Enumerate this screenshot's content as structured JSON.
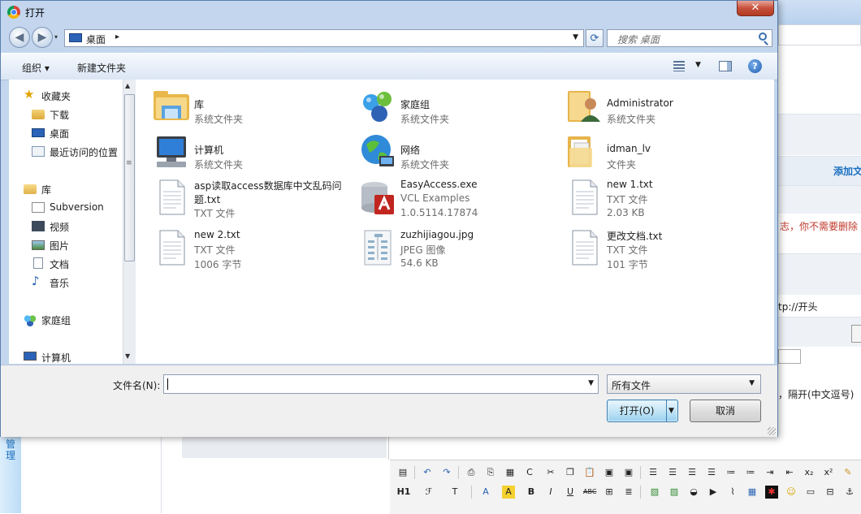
{
  "dialog": {
    "title": "打开",
    "close_glyph": "✕",
    "address": "桌面",
    "search_placeholder": "搜索 桌面",
    "toolbar": {
      "organize": "组织 ▾",
      "new_folder": "新建文件夹",
      "help_glyph": "?"
    },
    "nav": [
      {
        "label": "收藏夹",
        "icon": "star-icon"
      },
      {
        "label": "下载",
        "icon": "download-folder-icon"
      },
      {
        "label": "桌面",
        "icon": "desktop-icon"
      },
      {
        "label": "最近访问的位置",
        "icon": "recent-places-icon"
      },
      {
        "label": "库",
        "icon": "library-icon"
      },
      {
        "label": "Subversion",
        "icon": "folder-icon"
      },
      {
        "label": "视频",
        "icon": "video-icon"
      },
      {
        "label": "图片",
        "icon": "picture-icon"
      },
      {
        "label": "文档",
        "icon": "document-icon"
      },
      {
        "label": "音乐",
        "icon": "music-icon"
      },
      {
        "label": "家庭组",
        "icon": "homegroup-icon"
      },
      {
        "label": "计算机",
        "icon": "computer-icon"
      }
    ],
    "files": [
      {
        "name": "库",
        "sub1": "系统文件夹",
        "sub2": "",
        "icon": "library-icon"
      },
      {
        "name": "家庭组",
        "sub1": "系统文件夹",
        "sub2": "",
        "icon": "homegroup-icon"
      },
      {
        "name": "Administrator",
        "sub1": "系统文件夹",
        "sub2": "",
        "icon": "user-folder-icon"
      },
      {
        "name": "计算机",
        "sub1": "系统文件夹",
        "sub2": "",
        "icon": "computer-icon"
      },
      {
        "name": "网络",
        "sub1": "系统文件夹",
        "sub2": "",
        "icon": "network-icon"
      },
      {
        "name": "idman_lv",
        "sub1": "文件夹",
        "sub2": "",
        "icon": "folder-icon"
      },
      {
        "name": "asp读取access数据库中文乱码问",
        "name2": "题.txt",
        "sub1": "TXT 文件",
        "sub2": "",
        "icon": "text-file-icon"
      },
      {
        "name": "EasyAccess.exe",
        "sub1": "VCL Examples",
        "sub2": "1.0.5114.17874",
        "icon": "access-exe-icon"
      },
      {
        "name": "new 1.txt",
        "sub1": "TXT 文件",
        "sub2": "2.03 KB",
        "icon": "text-file-icon"
      },
      {
        "name": "new 2.txt",
        "sub1": "TXT 文件",
        "sub2": "1006 字节",
        "icon": "text-file-icon"
      },
      {
        "name": "zuzhijiagou.jpg",
        "sub1": "JPEG 图像",
        "sub2": "54.6 KB",
        "icon": "image-file-icon"
      },
      {
        "name": "更改文档.txt",
        "sub1": "TXT 文件",
        "sub2": "101 字节",
        "icon": "text-file-icon"
      }
    ],
    "filename_label": "文件名(N):",
    "filename_value": "",
    "filetype_value": "所有文件",
    "open_label": "打开(O)",
    "cancel_label": "取消"
  },
  "background": {
    "add_link": "添加文",
    "notice_text": "志，你不需要删除",
    "url_hint": "tp://开头",
    "separator_hint": "，隔开(中文逗号)",
    "side_tab": "管理",
    "editor_heading": "H1",
    "colors": {
      "notice": "#c0392b",
      "link": "#1a6fc0"
    }
  }
}
